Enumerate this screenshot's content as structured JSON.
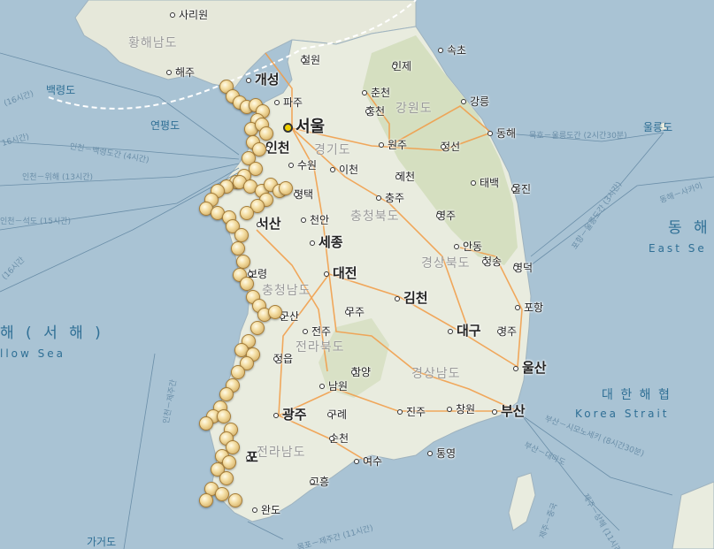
{
  "map": {
    "colors": {
      "sea": "#a9c3d4",
      "land": "#e9ecdf",
      "mountain": "#c9d8b4",
      "road": "#f29b45",
      "marker": "#f3dca0"
    },
    "seas": {
      "west_ko": "해 ( 서 해 )",
      "west_en": "llow Sea",
      "east_ko": "동 해",
      "east_en": "East Se",
      "strait_ko": "대 한 해 협",
      "strait_en": "Korea Strait"
    },
    "provinces": {
      "hwanghae_south": "황해남도",
      "gangwon": "강원도",
      "gyeonggi": "경기도",
      "chungbuk": "충청북도",
      "gyeongbuk": "경상북도",
      "chungnam": "충청남도",
      "jeonbuk": "전라북도",
      "gyeongnam": "경상남도",
      "jeonnam": "전라남도"
    },
    "cities": {
      "sariwon": "사리원",
      "haeju": "해주",
      "kaesong": "개성",
      "cheorwon": "철원",
      "inje": "인제",
      "sokcho": "속초",
      "paju": "파주",
      "chuncheon": "춘천",
      "gangneung": "강릉",
      "hongcheon": "홍천",
      "seoul": "서울",
      "incheon": "인천",
      "wonju": "원주",
      "jeongseon": "정선",
      "donghae": "동해",
      "suwon": "수원",
      "icheon": "이천",
      "jecheon": "제천",
      "taebaek": "태백",
      "uljin": "울진",
      "pyeongtaek": "평택",
      "chungju": "충주",
      "cheonan": "천안",
      "yeongju": "영주",
      "seosan": "서산",
      "sejong": "세종",
      "andong": "안동",
      "cheongsong": "청송",
      "yeongdeok": "영덕",
      "boryeong": "보령",
      "daejeon": "대전",
      "gimcheon": "김천",
      "pohang": "포항",
      "gunsan": "군산",
      "muju": "무주",
      "jeonju": "전주",
      "daegu": "대구",
      "gyeongju": "경주",
      "jeongeup": "정읍",
      "hamyang": "함양",
      "ulsan": "울산",
      "namwon": "남원",
      "gwangju": "광주",
      "gurye": "구례",
      "jinju": "진주",
      "changwon": "창원",
      "busan": "부산",
      "suncheon": "순천",
      "mokpo": "포",
      "yeosu": "여수",
      "tongyeong": "통영",
      "goheung": "고흥",
      "wando": "완도"
    },
    "islands": {
      "baengnyeong": "백령도",
      "yeonpyeong": "연평도",
      "ulleung": "울릉도",
      "gageo": "가거도"
    },
    "ferries": {
      "incheon_baengnyeong": "인천－백령도간 (4시간)",
      "incheon_wi": "인천－위해 (13시간)",
      "incheon_seok": "인천－석도 (15시간)",
      "mukho_ulleung": "묵호－울릉도간 (2시간30분)",
      "donghae_sakai": "동해－사카이",
      "busan_shimonoseki": "부산－시모노세키 (8시간30분)",
      "busan_daemado": "부산－대마도",
      "incheon_jeju": "인천－제주간",
      "mokpo_jeju": "목포－제주간 (11시간)",
      "left_16a": "(16시간)",
      "left_16b": "16시간)",
      "left_16c": "(16시간",
      "pohang_ulleung": "포항－울릉도간 (3시간)",
      "jeju_route": "제주－중국",
      "s_route": "제주－상해 (11시간)"
    },
    "markers_count": 64
  }
}
